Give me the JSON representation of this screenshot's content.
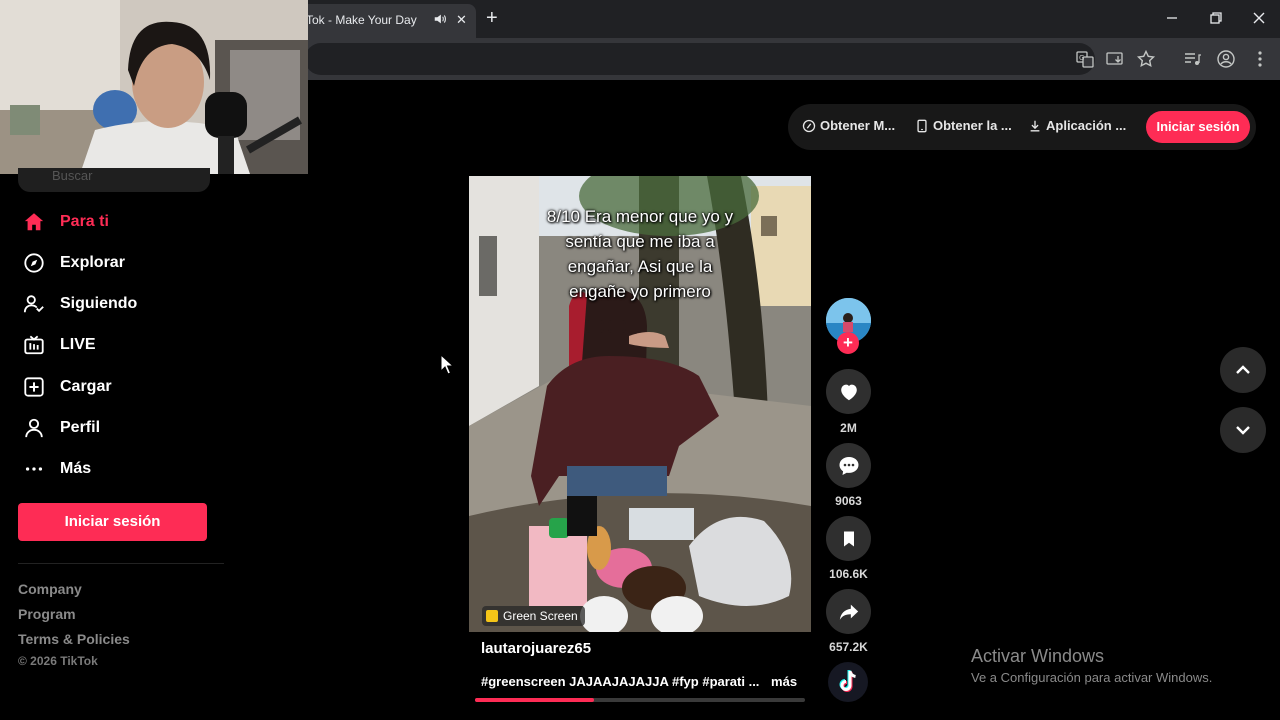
{
  "browser": {
    "tab_title": "Tok - Make Your Day",
    "new_tab_symbol": "+",
    "close_tab_symbol": "✕"
  },
  "sidebar": {
    "search_placeholder": "Buscar",
    "items": [
      {
        "label": "Para ti",
        "icon": "home-icon",
        "active": true
      },
      {
        "label": "Explorar",
        "icon": "compass-icon"
      },
      {
        "label": "Siguiendo",
        "icon": "following-icon"
      },
      {
        "label": "LIVE",
        "icon": "live-icon"
      },
      {
        "label": "Cargar",
        "icon": "upload-icon"
      },
      {
        "label": "Perfil",
        "icon": "profile-icon"
      },
      {
        "label": "Más",
        "icon": "more-icon"
      }
    ],
    "login_label": "Iniciar sesión",
    "footer": {
      "company": "Company",
      "program": "Program",
      "terms": "Terms & Policies",
      "copyright": "© 2026 TikTok"
    }
  },
  "top_actions": {
    "item1": "Obtener M...",
    "item2": "Obtener la ...",
    "item3": "Aplicación ...",
    "login_label": "Iniciar sesión"
  },
  "video": {
    "caption": [
      "8/10 Era menor que yo y",
      "sentía que me iba a",
      "engañar, Asi que la",
      "engañe yo primero"
    ],
    "badge": "Green Screen",
    "username": "lautarojuarez65",
    "description": "#greenscreen JAJAAJAJAJJA #fyp #parati ...",
    "more_label": "más",
    "progress_fraction": 0.36
  },
  "actions": {
    "follow_symbol": "+",
    "likes": "2M",
    "comments": "9063",
    "saves": "106.6K",
    "shares": "657.2K"
  },
  "watermark": {
    "title": "Activar Windows",
    "subtitle": "Ve a Configuración para activar Windows."
  },
  "colors": {
    "accent": "#fe2c55",
    "background": "#000000",
    "button_dark": "#2f2f2f"
  }
}
